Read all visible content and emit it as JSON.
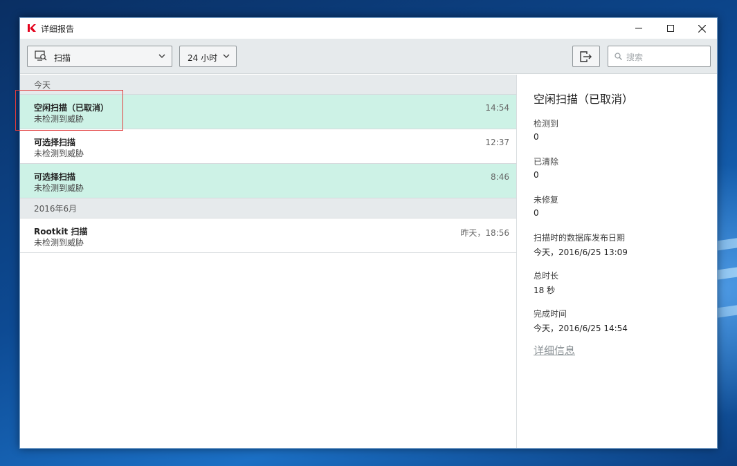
{
  "window": {
    "title": "详细报告",
    "controls": {
      "minimize": "minimize-icon",
      "maximize": "maximize-icon",
      "close": "close-icon"
    }
  },
  "toolbar": {
    "scan_filter": {
      "icon": "scan-monitor-icon",
      "selected": "扫描"
    },
    "time_filter": {
      "selected": "24 小时"
    },
    "export_icon": "export-icon",
    "search": {
      "placeholder": "搜索",
      "value": ""
    }
  },
  "list": {
    "groups": [
      {
        "header": "今天",
        "items": [
          {
            "title": "空闲扫描（已取消）",
            "subtitle": "未检测到威胁",
            "time": "14:54",
            "highlighted": true
          },
          {
            "title": "可选择扫描",
            "subtitle": "未检测到威胁",
            "time": "12:37",
            "highlighted": false
          },
          {
            "title": "可选择扫描",
            "subtitle": "未检测到威胁",
            "time": "8:46",
            "highlighted": true
          }
        ]
      },
      {
        "header": "2016年6月",
        "items": [
          {
            "title": "Rootkit 扫描",
            "subtitle": "未检测到威胁",
            "time": "昨天，18:56",
            "highlighted": false
          }
        ]
      }
    ]
  },
  "detail": {
    "title": "空闲扫描（已取消）",
    "fields": [
      {
        "label": "检测到",
        "value": "0"
      },
      {
        "label": "已清除",
        "value": "0"
      },
      {
        "label": "未修复",
        "value": "0"
      },
      {
        "label": "扫描时的数据库发布日期",
        "value": "今天，2016/6/25 13:09"
      },
      {
        "label": "总时长",
        "value": "18 秒"
      },
      {
        "label": "完成时间",
        "value": "今天，2016/6/25 14:54"
      }
    ],
    "link": "详细信息"
  },
  "colors": {
    "highlight_row": "#cdf2e6",
    "annotation_box": "#e23b3b",
    "brand_red": "#e3001b"
  }
}
